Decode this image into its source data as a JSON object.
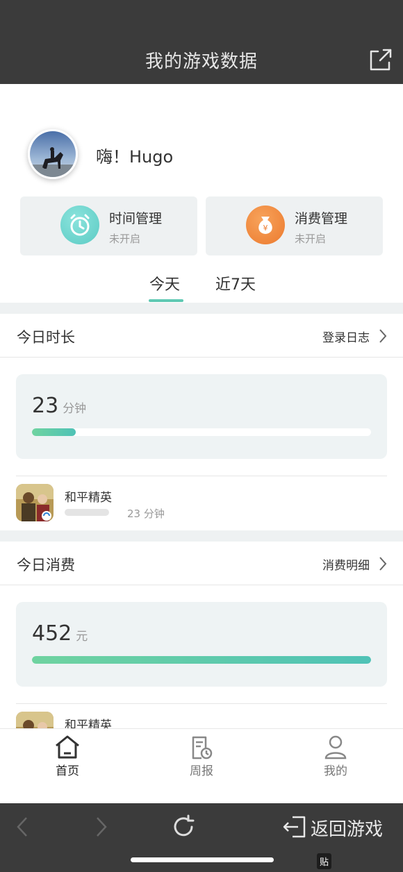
{
  "header": {
    "title": "我的游戏数据",
    "share_icon": "share-icon"
  },
  "profile": {
    "greeting": "嗨！Hugo"
  },
  "management": [
    {
      "title": "时间管理",
      "status": "未开启",
      "icon": "alarm-clock-icon",
      "color": "#6fd6d0"
    },
    {
      "title": "消费管理",
      "status": "未开启",
      "icon": "money-bag-icon",
      "color": "#f0893a"
    }
  ],
  "tabs": [
    {
      "label": "今天"
    },
    {
      "label": "近7天"
    }
  ],
  "today_duration": {
    "title": "今日时长",
    "link": "登录日志",
    "value": "23",
    "unit": "分钟",
    "progress_fraction": 0.13,
    "game": {
      "name": "和平精英",
      "time": "23 分钟"
    }
  },
  "today_spend": {
    "title": "今日消费",
    "link": "消费明细",
    "value": "452",
    "unit": "元",
    "progress_fraction": 1.0,
    "game": {
      "name": "和平精英"
    }
  },
  "bottom_nav": [
    {
      "label": "首页",
      "icon": "home-icon",
      "active": true
    },
    {
      "label": "周报",
      "icon": "report-icon",
      "active": false
    },
    {
      "label": "我的",
      "icon": "user-icon",
      "active": false
    }
  ],
  "browser_bar": {
    "return_label": "返回游戏",
    "watermark": "贴"
  },
  "colors": {
    "accent": "#5fc9b3",
    "bar_dark": "#3b3b3b"
  }
}
